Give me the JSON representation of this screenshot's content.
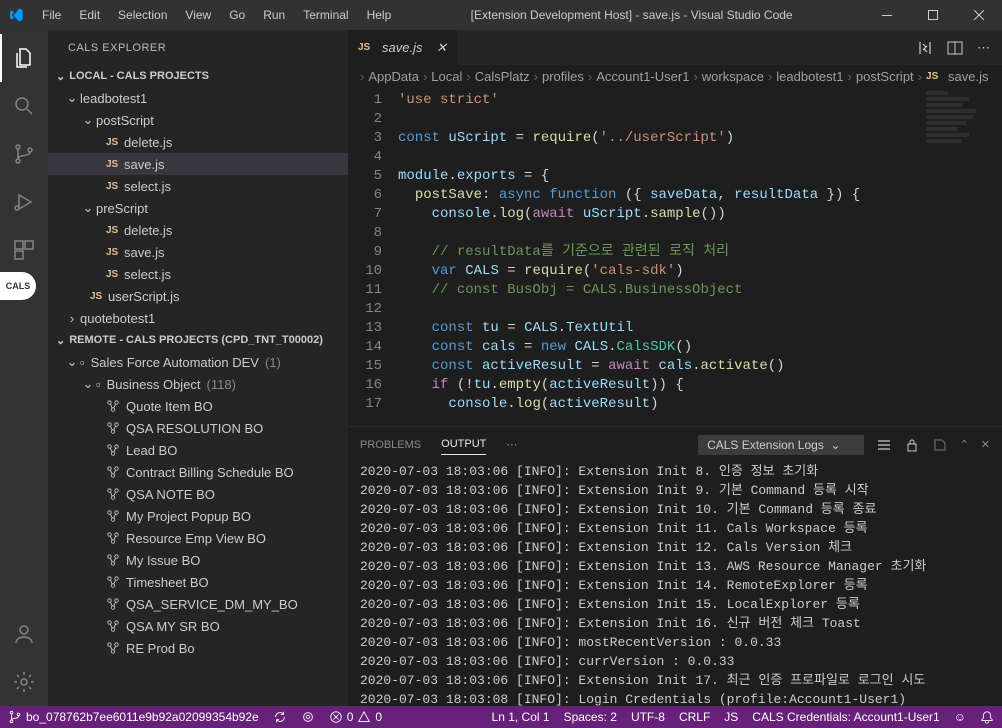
{
  "titlebar": {
    "menus": [
      "File",
      "Edit",
      "Selection",
      "View",
      "Go",
      "Run",
      "Terminal",
      "Help"
    ],
    "title": "[Extension Development Host] - save.js - Visual Studio Code"
  },
  "sidebar": {
    "title": "CALS EXPLORER",
    "section_local": "LOCAL - CALS PROJECTS",
    "section_remote": "REMOTE - CALS PROJECTS (CPD_TNT_T00002)",
    "local_tree": {
      "project": "leadbotest1",
      "postScript": {
        "label": "postScript",
        "files": [
          "delete.js",
          "save.js",
          "select.js"
        ]
      },
      "preScript": {
        "label": "preScript",
        "files": [
          "delete.js",
          "save.js",
          "select.js"
        ]
      },
      "userScript": "userScript.js",
      "quote": "quotebotest1"
    },
    "remote_tree": {
      "sfa": "Sales Force Automation DEV",
      "sfa_count": "(1)",
      "bo": "Business Object",
      "bo_count": "(118)",
      "items": [
        "Quote Item BO",
        "QSA RESOLUTION BO",
        "Lead BO",
        "Contract Billing Schedule BO",
        "QSA NOTE BO",
        "My Project Popup BO",
        "Resource Emp View BO",
        "My Issue BO",
        "Timesheet BO",
        "QSA_SERVICE_DM_MY_BO",
        "QSA MY SR BO",
        "RE Prod Bo"
      ]
    }
  },
  "tabs": {
    "active": "save.js"
  },
  "breadcrumb": [
    "AppData",
    "Local",
    "CalsPlatz",
    "profiles",
    "Account1-User1",
    "workspace",
    "leadbotest1",
    "postScript",
    "save.js"
  ],
  "code": {
    "line_numbers": [
      1,
      2,
      3,
      4,
      5,
      6,
      7,
      8,
      9,
      10,
      11,
      12,
      13,
      14,
      15,
      16,
      17
    ]
  },
  "panel": {
    "tabs": {
      "problems": "PROBLEMS",
      "output": "OUTPUT"
    },
    "dropdown": "CALS Extension Logs",
    "logs": [
      "2020-07-03 18:03:06 [INFO]: Extension Init 8. 인증 정보 초기화",
      "2020-07-03 18:03:06 [INFO]: Extension Init 9. 기본 Command 등록 시작",
      "2020-07-03 18:03:06 [INFO]: Extension Init 10. 기본 Command 등록 종료",
      "2020-07-03 18:03:06 [INFO]: Extension Init 11. Cals Workspace 등록",
      "2020-07-03 18:03:06 [INFO]: Extension Init 12. Cals Version 체크",
      "2020-07-03 18:03:06 [INFO]: Extension Init 13. AWS Resource Manager 초기화",
      "2020-07-03 18:03:06 [INFO]: Extension Init 14. RemoteExplorer 등록",
      "2020-07-03 18:03:06 [INFO]: Extension Init 15. LocalExplorer 등록",
      "2020-07-03 18:03:06 [INFO]: Extension Init 16. 신규 버전 체크 Toast",
      "2020-07-03 18:03:06 [INFO]: mostRecentVersion : 0.0.33",
      "2020-07-03 18:03:06 [INFO]: currVersion : 0.0.33",
      "2020-07-03 18:03:06 [INFO]: Extension Init 17. 최근 인증 프로파일로 로그인 시도",
      "2020-07-03 18:03:08 [INFO]: Login Credentials (profile:Account1-User1)"
    ]
  },
  "statusbar": {
    "branch": "bo_078762b7ee6011e9b92a02099354b92e",
    "errors": "0",
    "warnings": "0",
    "cursor": "Ln 1, Col 1",
    "spaces": "Spaces: 2",
    "encoding": "UTF-8",
    "eol": "CRLF",
    "lang": "JS",
    "creds": "CALS Credentials: Account1-User1"
  }
}
